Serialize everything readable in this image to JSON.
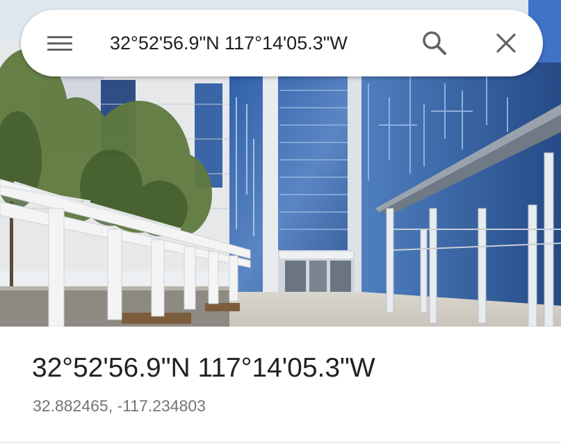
{
  "search_bar": {
    "query": "32°52'56.9\"N 117°14'05.3\"W",
    "menu_icon": "hamburger-menu-icon",
    "search_icon": "magnifier-icon",
    "close_icon": "close-x-icon"
  },
  "photo": {
    "subject": "building-photo"
  },
  "place": {
    "title": "32°52'56.9\"N 117°14'05.3\"W",
    "decimal_coordinates": "32.882465, -117.234803"
  },
  "colors": {
    "icon_gray": "#5f6368",
    "title_text": "#202124",
    "secondary_text": "#70757a",
    "divider": "#dadce0"
  }
}
